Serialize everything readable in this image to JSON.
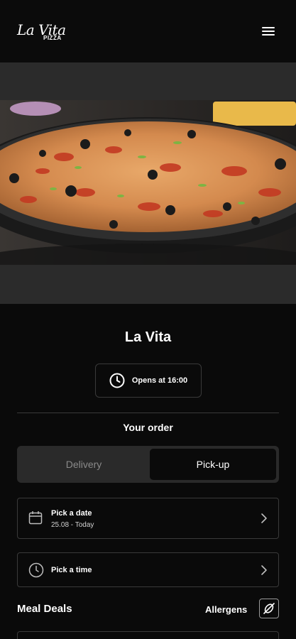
{
  "header": {
    "logo_script": "La Vita",
    "logo_sub": "PIZZA",
    "menu_icon": "hamburger-menu-icon"
  },
  "hero": {
    "image": "pizza-photo"
  },
  "restaurant": {
    "name": "La Vita",
    "hours_text": "Opens at 16:00",
    "hours_icon": "clock-icon"
  },
  "order": {
    "title": "Your order",
    "modes": [
      {
        "label": "Delivery",
        "selected": false
      },
      {
        "label": "Pick-up",
        "selected": true
      }
    ],
    "date": {
      "label": "Pick a date",
      "value": "25.08 - Today",
      "icon": "calendar-icon"
    },
    "time": {
      "label": "Pick a time",
      "icon": "clock-icon"
    }
  },
  "menu": {
    "section_title": "Meal Deals",
    "allergens_label": "Allergens",
    "allergens_icon": "no-allergens-icon"
  },
  "colors": {
    "background": "#0a0a0a",
    "surface": "#2a2a2a",
    "border": "#3a3a3a",
    "text": "#ffffff",
    "muted": "#8a8a8a"
  }
}
